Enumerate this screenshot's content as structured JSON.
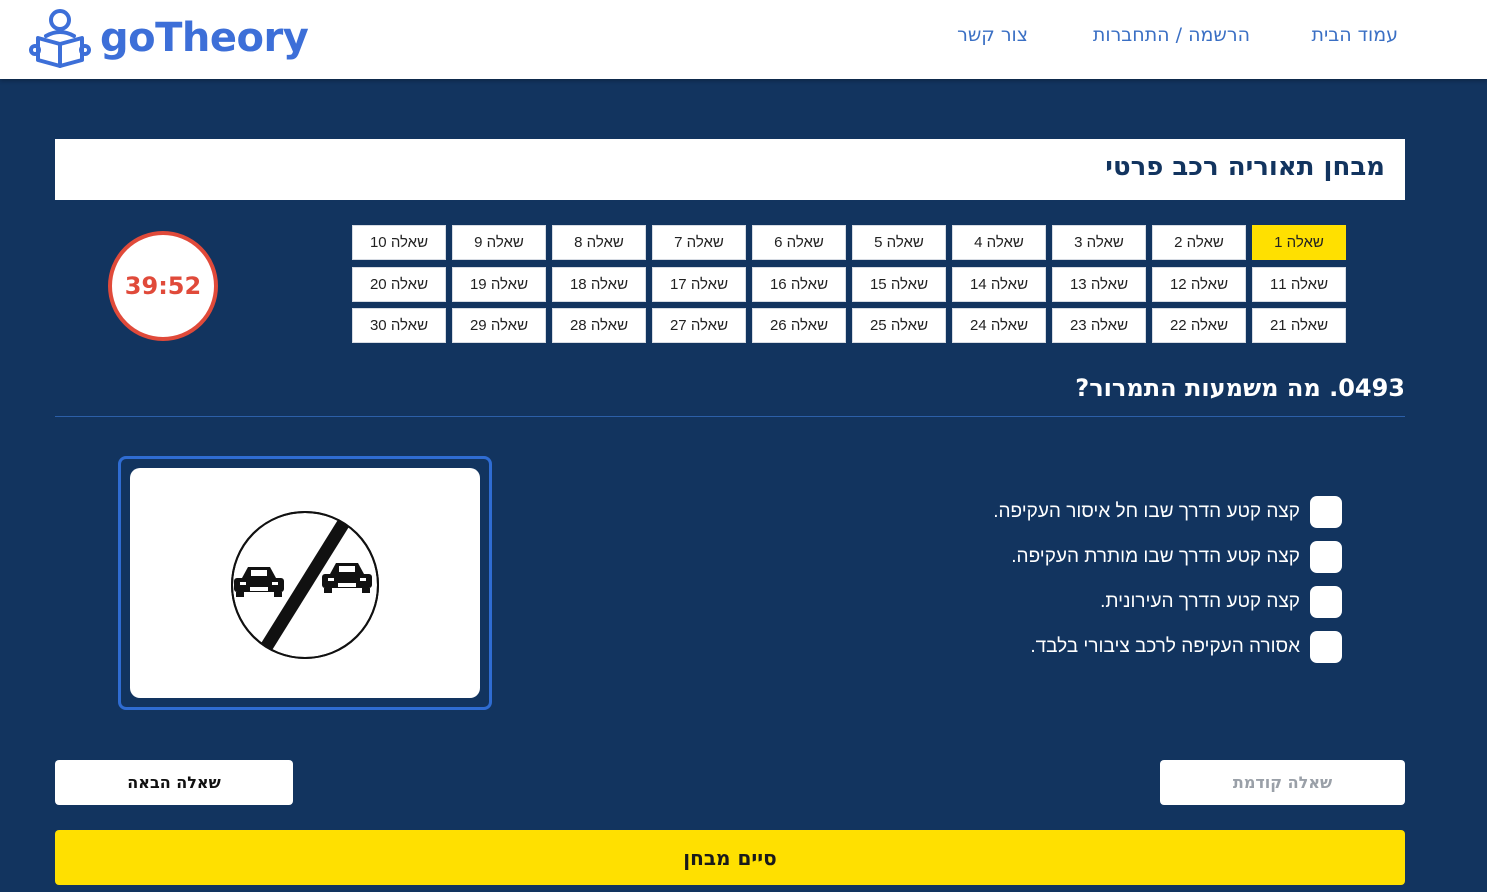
{
  "header": {
    "logo_text": "goTheory",
    "nav": {
      "home": "עמוד הבית",
      "register": "הרשמה / התחברות",
      "contact": "צור קשר"
    }
  },
  "exam": {
    "title": "מבחן תאוריה רכב פרטי",
    "timer": "39:52",
    "active_question": 1,
    "question_buttons": [
      "שאלה 1",
      "שאלה 2",
      "שאלה 3",
      "שאלה 4",
      "שאלה 5",
      "שאלה 6",
      "שאלה 7",
      "שאלה 8",
      "שאלה 9",
      "שאלה 10",
      "שאלה 11",
      "שאלה 12",
      "שאלה 13",
      "שאלה 14",
      "שאלה 15",
      "שאלה 16",
      "שאלה 17",
      "שאלה 18",
      "שאלה 19",
      "שאלה 20",
      "שאלה 21",
      "שאלה 22",
      "שאלה 23",
      "שאלה 24",
      "שאלה 25",
      "שאלה 26",
      "שאלה 27",
      "שאלה 28",
      "שאלה 29",
      "שאלה 30"
    ]
  },
  "question": {
    "text": "0493. מה משמעות התמרור?",
    "image_icon": "end-of-no-overtaking-sign-icon",
    "answers": [
      "קצה קטע הדרך שבו חל איסור העקיפה.",
      "קצה קטע הדרך שבו מותרת העקיפה.",
      "קצה קטע הדרך העירונית.",
      "אסורה העקיפה לרכב ציבורי בלבד."
    ]
  },
  "buttons": {
    "next": "שאלה הבאה",
    "prev": "שאלה קודמת",
    "finish": "סיים מבחן"
  },
  "colors": {
    "background": "#12345f",
    "accent_yellow": "#ffe000",
    "timer_red": "#e04a3a",
    "brand_blue": "#3d6fd8"
  }
}
